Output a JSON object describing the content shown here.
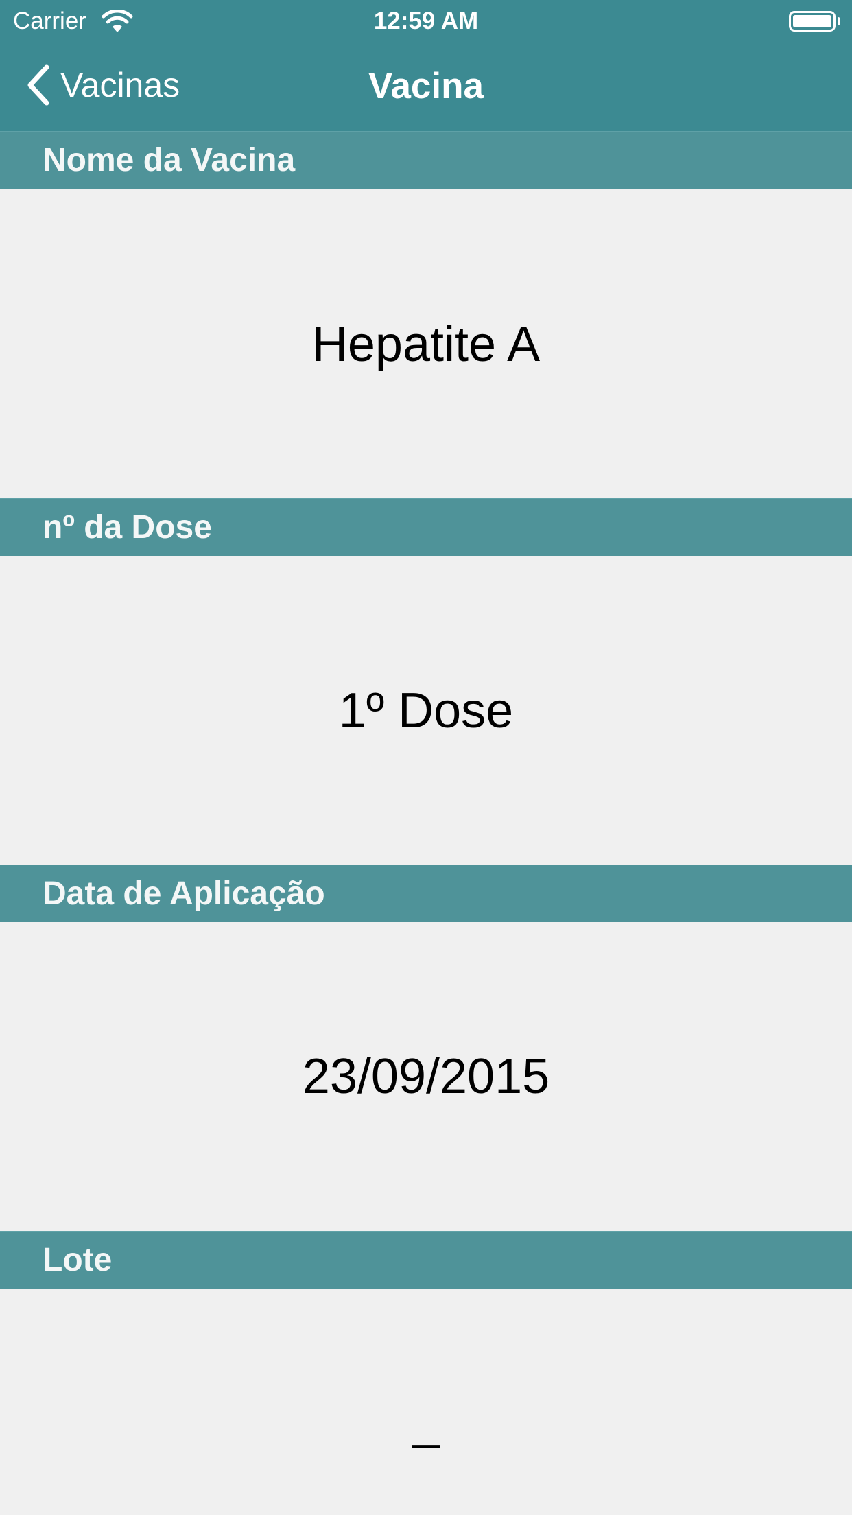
{
  "status_bar": {
    "carrier": "Carrier",
    "time": "12:59 AM",
    "wifi_icon": "wifi-icon",
    "battery_icon": "battery-icon"
  },
  "navigation": {
    "back_label": "Vacinas",
    "back_icon": "chevron-left-icon",
    "title": "Vacina"
  },
  "sections": [
    {
      "header": "Nome da Vacina",
      "value": "Hepatite A"
    },
    {
      "header": "nº da Dose",
      "value": "1º Dose"
    },
    {
      "header": "Data de Aplicação",
      "value": "23/09/2015"
    },
    {
      "header": "Lote",
      "value": "–"
    }
  ],
  "colors": {
    "nav_background": "#3c8a92",
    "section_header_background": "#4f9399",
    "content_background": "#f0f0f0",
    "nav_text": "#ffffff"
  }
}
